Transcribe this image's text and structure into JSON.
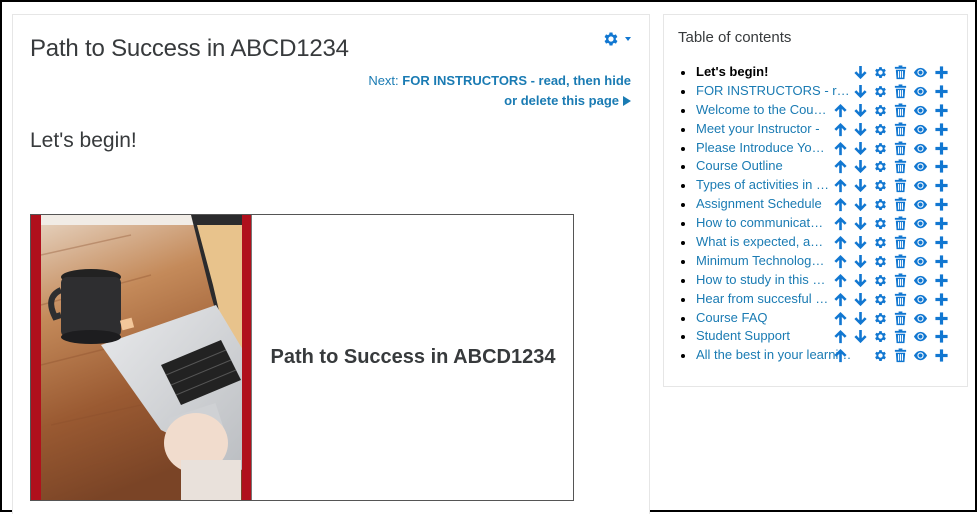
{
  "page": {
    "title": "Path to Success in ABCD1234",
    "next_label": "Next:",
    "next_title_line1": "FOR INSTRUCTORS - read, then hide",
    "next_title_line2": "or delete this page",
    "section_heading": "Let's begin!",
    "banner_title": "Path to Success in ABCD1234"
  },
  "colors": {
    "link": "#1a7bb3",
    "icon": "#1177d1",
    "banner_accent": "#b0101c"
  },
  "toc": {
    "title": "Table of contents",
    "items": [
      {
        "label": "Let's begin!",
        "current": true,
        "up": false,
        "down": true
      },
      {
        "label": "FOR INSTRUCTORS - read, then hide or delete this page",
        "current": false,
        "up": false,
        "down": true
      },
      {
        "label": "Welcome to the Course",
        "current": false,
        "up": true,
        "down": true
      },
      {
        "label": "Meet your Instructor -",
        "current": false,
        "up": true,
        "down": true
      },
      {
        "label": "Please Introduce Yourself",
        "current": false,
        "up": true,
        "down": true
      },
      {
        "label": "Course Outline",
        "current": false,
        "up": true,
        "down": true
      },
      {
        "label": "Types of activities in this course",
        "current": false,
        "up": true,
        "down": true
      },
      {
        "label": "Assignment Schedule",
        "current": false,
        "up": true,
        "down": true
      },
      {
        "label": "How to communicate with your instructor",
        "current": false,
        "up": true,
        "down": true
      },
      {
        "label": "What is expected, and what to expect",
        "current": false,
        "up": true,
        "down": true
      },
      {
        "label": "Minimum Technology Requirements",
        "current": false,
        "up": true,
        "down": true
      },
      {
        "label": "How to study in this course",
        "current": false,
        "up": true,
        "down": true
      },
      {
        "label": "Hear from succesful students",
        "current": false,
        "up": true,
        "down": true
      },
      {
        "label": "Course FAQ",
        "current": false,
        "up": true,
        "down": true
      },
      {
        "label": "Student Support",
        "current": false,
        "up": true,
        "down": true
      },
      {
        "label": "All the best in your learning",
        "current": false,
        "up": true,
        "down": false
      }
    ],
    "icons": [
      "arrow-up-icon",
      "arrow-down-icon",
      "gear-icon",
      "trash-icon",
      "eye-icon",
      "plus-icon"
    ]
  }
}
